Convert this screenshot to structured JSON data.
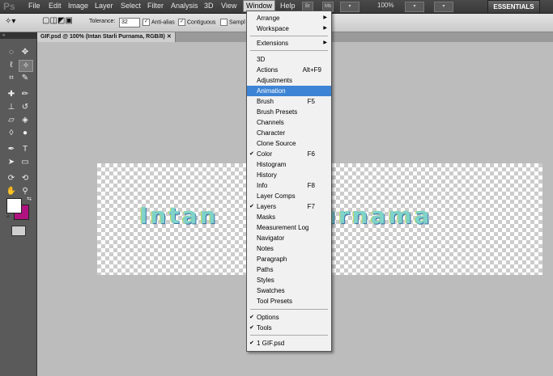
{
  "app": {
    "logo": "Ps"
  },
  "menubar": {
    "items": [
      "File",
      "Edit",
      "Image",
      "Layer",
      "Select",
      "Filter",
      "Analysis",
      "3D",
      "View",
      "Window",
      "Help"
    ],
    "active": "Window",
    "zoom": "100%",
    "workspace": "ESSENTIALS"
  },
  "options": {
    "tolerance_label": "Tolerance:",
    "tolerance_value": "32",
    "anti_alias": "Anti-alias",
    "contiguous": "Contiguous",
    "sample": "Sampl"
  },
  "document": {
    "tab_title": "GIF.psd @ 100% (Intan Starli Purnama, RGB/8)",
    "canvas_text": "Intan      i Purnama"
  },
  "colors": {
    "foreground": "#ffffff",
    "background": "#b0137f",
    "highlight": "#3d84d4"
  },
  "window_menu": {
    "items": [
      {
        "label": "Arrange",
        "submenu": true
      },
      {
        "label": "Workspace",
        "submenu": true
      },
      {
        "label": "Extensions",
        "submenu": true
      },
      {
        "label": "3D"
      },
      {
        "label": "Actions",
        "shortcut": "Alt+F9"
      },
      {
        "label": "Adjustments"
      },
      {
        "label": "Animation",
        "highlighted": true
      },
      {
        "label": "Brush",
        "shortcut": "F5"
      },
      {
        "label": "Brush Presets"
      },
      {
        "label": "Channels"
      },
      {
        "label": "Character"
      },
      {
        "label": "Clone Source"
      },
      {
        "label": "Color",
        "shortcut": "F6",
        "checked": true
      },
      {
        "label": "Histogram"
      },
      {
        "label": "History"
      },
      {
        "label": "Info",
        "shortcut": "F8"
      },
      {
        "label": "Layer Comps"
      },
      {
        "label": "Layers",
        "shortcut": "F7",
        "checked": true
      },
      {
        "label": "Masks"
      },
      {
        "label": "Measurement Log"
      },
      {
        "label": "Navigator"
      },
      {
        "label": "Notes"
      },
      {
        "label": "Paragraph"
      },
      {
        "label": "Paths"
      },
      {
        "label": "Styles"
      },
      {
        "label": "Swatches"
      },
      {
        "label": "Tool Presets"
      },
      {
        "label": "Options",
        "checked": true
      },
      {
        "label": "Tools",
        "checked": true
      },
      {
        "label": "1 GIF.psd",
        "checked": true
      }
    ]
  }
}
